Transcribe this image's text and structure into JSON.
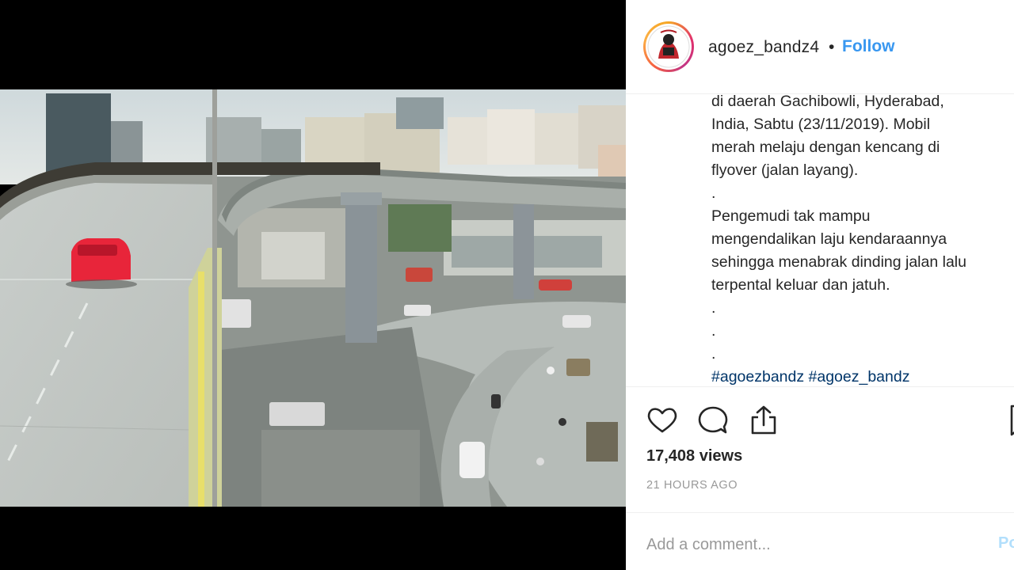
{
  "post": {
    "username": "agoez_bandz4",
    "separator": "•",
    "follow_label": "Follow",
    "caption_lines": [
      "di daerah Gachibowli, Hyderabad,",
      "India, Sabtu (23/11/2019). Mobil",
      "merah melaju dengan kencang di",
      "flyover (jalan layang).",
      ".",
      "Pengemudi tak mampu",
      "mengendalikan laju kendaraannya",
      "sehingga menabrak dinding jalan lalu",
      "terpental keluar dan jatuh.",
      ".",
      ".",
      "."
    ],
    "hashtags": "#agoezbandz #agoez_bandz",
    "views": "17,408 views",
    "time_ago": "21 HOURS AGO",
    "comment_placeholder": "Add a comment...",
    "post_label": "Po"
  },
  "icons": {
    "like": "heart-icon",
    "comment": "comment-bubble-icon",
    "share": "share-icon",
    "save": "bookmark-icon"
  },
  "colors": {
    "follow": "#3897f0",
    "hashtag": "#003569",
    "text": "#262626",
    "muted": "#999999",
    "car": "#e8253a"
  }
}
